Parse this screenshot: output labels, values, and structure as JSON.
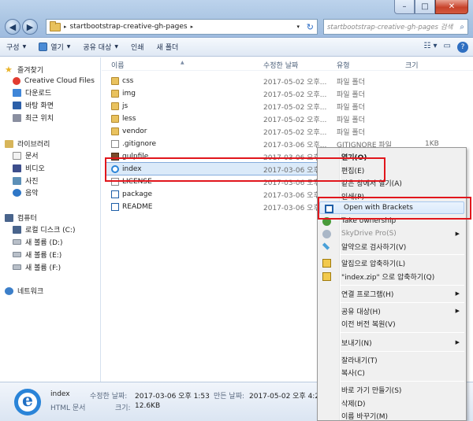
{
  "window": {
    "min_label": "–",
    "max_label": "□",
    "close_label": "✕"
  },
  "address": {
    "path": "startbootstrap-creative-gh-pages",
    "arrow": "▸",
    "dropdown": "▾",
    "refresh": "↻"
  },
  "search": {
    "placeholder": "startbootstrap-creative-gh-pages 검색",
    "icon": "⌕"
  },
  "toolbar": {
    "organize": "구성",
    "open": "열기",
    "share": "공유 대상",
    "print": "인쇄",
    "new_folder": "새 폴더",
    "caret": "▼",
    "view_icon": "☷ ▾",
    "pane_icon": "▭",
    "help": "?"
  },
  "nav": {
    "favorites": "즐겨찾기",
    "creative_cloud": "Creative Cloud Files",
    "downloads": "다운로드",
    "desktop": "바탕 화면",
    "recent": "최근 위치",
    "libraries": "라이브러리",
    "documents": "문서",
    "videos": "비디오",
    "pictures": "사진",
    "music": "음악",
    "computer": "컴퓨터",
    "local_c": "로컬 디스크 (C:)",
    "vol_d": "새 볼륨 (D:)",
    "vol_e": "새 볼륨 (E:)",
    "vol_f": "새 볼륨 (F:)",
    "network": "네트워크"
  },
  "columns": {
    "name": "이름",
    "date": "수정한 날짜",
    "type": "유형",
    "size": "크기",
    "sort": "▲"
  },
  "files": [
    {
      "name": "css",
      "date": "2017-05-02 오후...",
      "type": "파일 폴더",
      "size": ""
    },
    {
      "name": "img",
      "date": "2017-05-02 오후...",
      "type": "파일 폴더",
      "size": ""
    },
    {
      "name": "js",
      "date": "2017-05-02 오후...",
      "type": "파일 폴더",
      "size": ""
    },
    {
      "name": "less",
      "date": "2017-05-02 오후...",
      "type": "파일 폴더",
      "size": ""
    },
    {
      "name": "vendor",
      "date": "2017-05-02 오후...",
      "type": "파일 폴더",
      "size": ""
    },
    {
      "name": ".gitignore",
      "date": "2017-03-06 오후...",
      "type": "GITIGNORE 파일",
      "size": "1KB"
    },
    {
      "name": "gulpfile",
      "date": "2017-03-06 오후...",
      "type": "",
      "size": ""
    },
    {
      "name": "index",
      "date": "2017-03-06 오후...",
      "type": "",
      "size": ""
    },
    {
      "name": "LICENSE",
      "date": "2017-03-06 오후...",
      "type": "",
      "size": ""
    },
    {
      "name": "package",
      "date": "2017-03-06 오후...",
      "type": "",
      "size": ""
    },
    {
      "name": "README",
      "date": "2017-03-06 오후...",
      "type": "",
      "size": ""
    }
  ],
  "details": {
    "name": "index",
    "type": "HTML 문서",
    "modified_label": "수정한 날짜:",
    "modified": "2017-03-06 오후 1:53",
    "created_label": "만든 날짜:",
    "created": "2017-05-02 오후 4:28",
    "size_label": "크기:",
    "size": "12.6KB"
  },
  "context_menu": {
    "open": "열기(O)",
    "edit": "편집(E)",
    "open_new_window": "같은 창에서 열기(A)",
    "print": "인쇄(P)",
    "open_with_brackets": "Open with Brackets",
    "take_ownership": "Take ownership",
    "skydrive": "SkyDrive Pro(S)",
    "scan": "알약으로 검사하기(V)",
    "compress": "알집으로 압축하기(L)",
    "compress_zip": "\"index.zip\" 으로 압축하기(Q)",
    "open_with": "연결 프로그램(H)",
    "share_with": "공유 대상(H)",
    "restore": "이전 버전 복원(V)",
    "send_to": "보내기(N)",
    "cut": "잘라내기(T)",
    "copy": "복사(C)",
    "shortcut": "바로 가기 만들기(S)",
    "delete": "삭제(D)",
    "rename": "이름 바꾸기(M)",
    "submenu_arrow": "▶"
  }
}
